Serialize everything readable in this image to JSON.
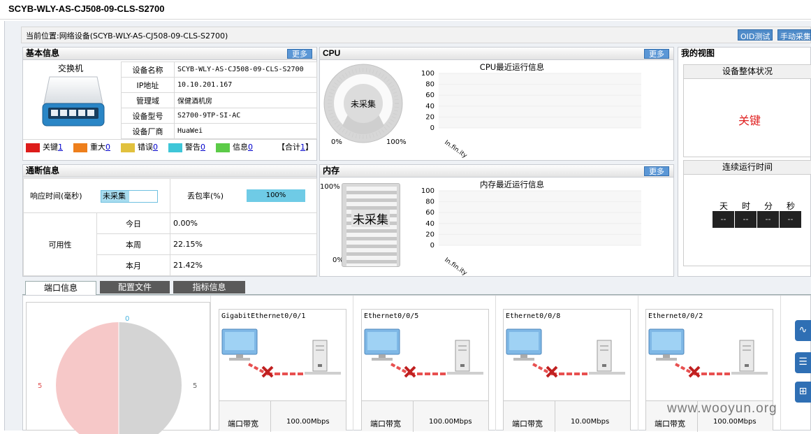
{
  "window_title": "SCYB-WLY-AS-CJ508-09-CLS-S2700",
  "breadcrumb": "当前位置:网络设备(SCYB-WLY-AS-CJ508-09-CLS-S2700)",
  "toolbar": {
    "oid_test": "OID测试",
    "manual_collect": "手动采集"
  },
  "basic": {
    "title": "基本信息",
    "more": "更多",
    "device_type": "交换机",
    "rows": [
      {
        "label": "设备名称",
        "value": "SCYB-WLY-AS-CJ508-09-CLS-S2700"
      },
      {
        "label": "IP地址",
        "value": "10.10.201.167"
      },
      {
        "label": "管理域",
        "value": "保健酒机房"
      },
      {
        "label": "设备型号",
        "value": "S2700-9TP-SI-AC"
      },
      {
        "label": "设备厂商",
        "value": "HuaWei"
      }
    ],
    "severity": [
      {
        "label": "关键",
        "count": "1",
        "color": "#dd1c1a"
      },
      {
        "label": "重大",
        "count": "0",
        "color": "#ee7f1c"
      },
      {
        "label": "错误",
        "count": "0",
        "color": "#e1c13e"
      },
      {
        "label": "警告",
        "count": "0",
        "color": "#3ec6d8"
      },
      {
        "label": "信息",
        "count": "0",
        "color": "#5ccb48"
      }
    ],
    "total_label": "【合计",
    "total_count": "1",
    "total_close": "】"
  },
  "cpu": {
    "title": "CPU",
    "more": "更多",
    "gauge_text": "未采集",
    "gauge_min": "0%",
    "gauge_max": "100%",
    "chart_title": "CPU最近运行信息",
    "xlabel": "In.fin.ity"
  },
  "reach": {
    "title": "通断信息",
    "response_label": "响应时间(毫秒)",
    "response_value": "未采集",
    "loss_label": "丢包率(%)",
    "loss_value": "100%",
    "avail_label": "可用性",
    "avail": [
      {
        "period": "今日",
        "value": "0.00%"
      },
      {
        "period": "本周",
        "value": "22.15%"
      },
      {
        "period": "本月",
        "value": "21.42%"
      }
    ]
  },
  "memory": {
    "title": "内存",
    "more": "更多",
    "bar_text": "未采集",
    "top": "100%",
    "bottom": "0%",
    "chart_title": "内存最近运行信息",
    "xlabel": "In.fin.ity"
  },
  "myview": {
    "title": "我的视图",
    "overall_label": "设备整体状况",
    "overall_value": "关键",
    "uptime_label": "连续运行时间",
    "units": [
      "天",
      "时",
      "分",
      "秒"
    ],
    "values": [
      "--",
      "--",
      "--",
      "--"
    ]
  },
  "tabs": [
    "端口信息",
    "配置文件",
    "指标信息"
  ],
  "pie": {
    "top": "0",
    "left": "5",
    "right": "5"
  },
  "ports": [
    {
      "name": "GigabitEthernet0/0/1",
      "bw_label": "端口带宽",
      "bw": "100.00Mbps"
    },
    {
      "name": "Ethernet0/0/5",
      "bw_label": "端口带宽",
      "bw": "100.00Mbps"
    },
    {
      "name": "Ethernet0/0/8",
      "bw_label": "端口带宽",
      "bw": "10.00Mbps"
    },
    {
      "name": "Ethernet0/0/2",
      "bw_label": "端口带宽",
      "bw": "100.00Mbps"
    }
  ],
  "watermark": "www.wooyun.org",
  "chart_data": [
    {
      "type": "line",
      "title": "CPU最近运行信息",
      "xlabel": "In.fin.ity",
      "ylim": [
        0,
        100
      ],
      "yticks": [
        0,
        20,
        40,
        60,
        80,
        100
      ],
      "series": []
    },
    {
      "type": "line",
      "title": "内存最近运行信息",
      "xlabel": "In.fin.ity",
      "ylim": [
        0,
        100
      ],
      "yticks": [
        0,
        20,
        40,
        60,
        80,
        100
      ],
      "series": []
    }
  ]
}
